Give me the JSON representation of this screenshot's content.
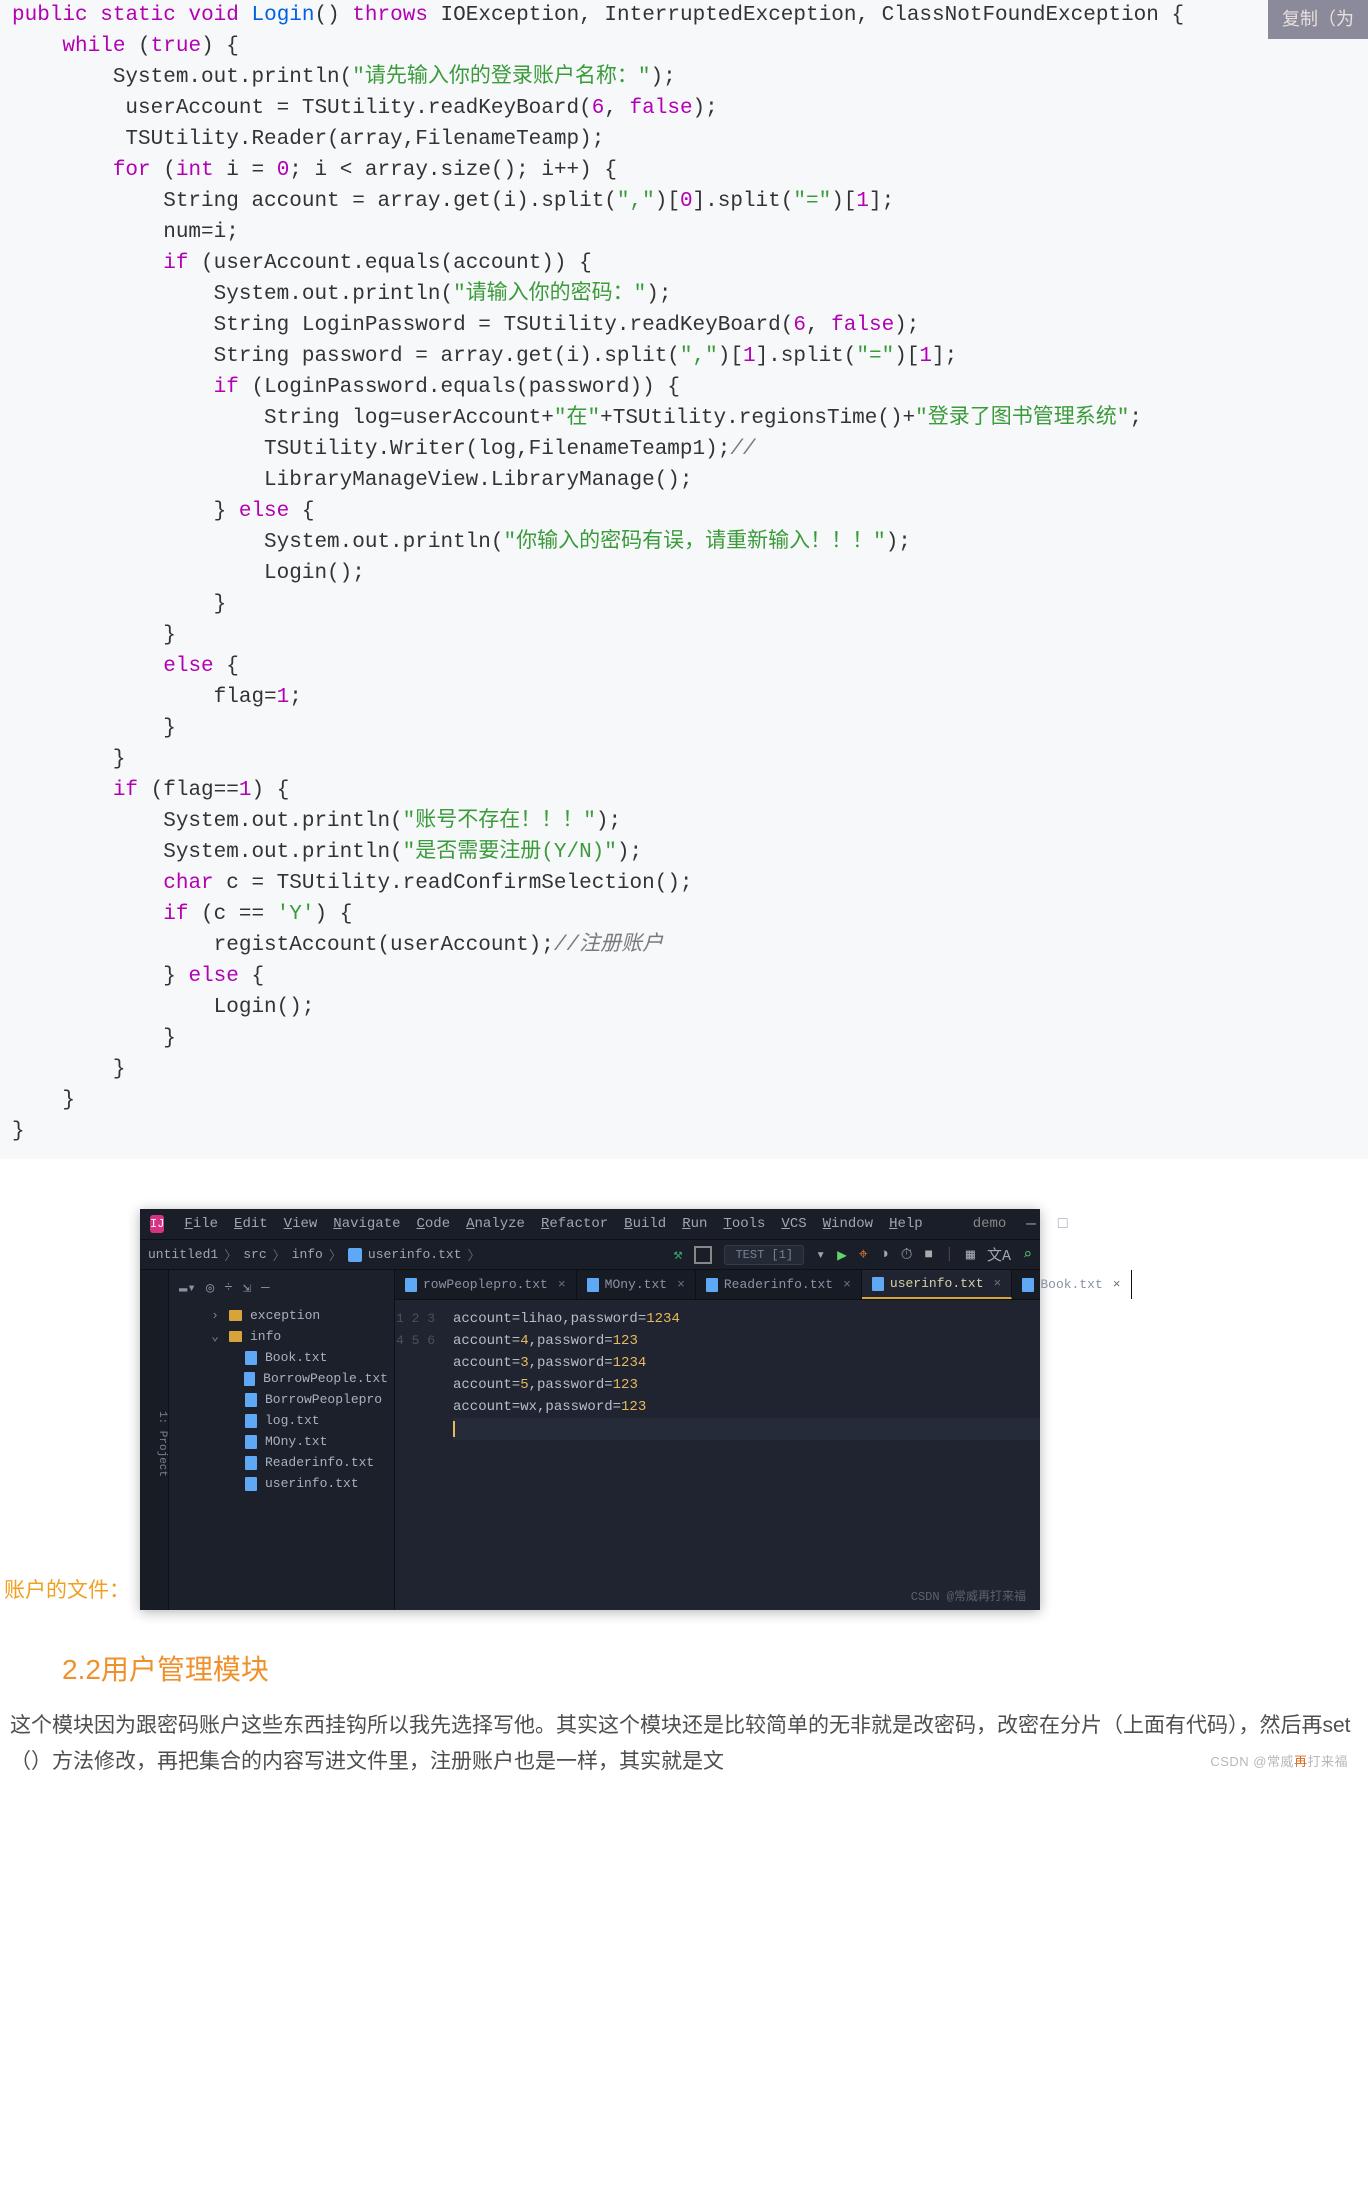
{
  "code": {
    "copy_label": "复制（为",
    "tokens": [
      [
        [
          "kw",
          "public"
        ],
        [
          "",
          0
        ],
        [
          "kw",
          "static"
        ],
        [
          "",
          0
        ],
        [
          "kw",
          "void"
        ],
        [
          "",
          0
        ],
        [
          "fn",
          "Login"
        ],
        [
          "",
          "() "
        ],
        [
          "kw",
          "throws"
        ],
        [
          "",
          " IOException, InterruptedException, ClassNotFoundException {"
        ]
      ],
      [
        [
          "",
          "    "
        ],
        [
          "kw",
          "while"
        ],
        [
          "",
          " ("
        ],
        [
          "bool",
          "true"
        ],
        [
          "",
          ") {"
        ]
      ],
      [
        [
          "",
          "        System.out.println("
        ],
        [
          "str",
          "\"请先输入你的登录账户名称：\""
        ],
        [
          "",
          ");"
        ]
      ],
      [
        [
          "",
          "         userAccount = TSUtility.readKeyBoard("
        ],
        [
          "num",
          "6"
        ],
        [
          "",
          ", "
        ],
        [
          "bool",
          "false"
        ],
        [
          "",
          ");"
        ]
      ],
      [
        [
          "",
          "         TSUtility.Reader(array,FilenameTeamp);"
        ]
      ],
      [
        [
          "",
          "        "
        ],
        [
          "kw",
          "for"
        ],
        [
          "",
          " ("
        ],
        [
          "kw",
          "int"
        ],
        [
          "",
          " i = "
        ],
        [
          "num",
          "0"
        ],
        [
          "",
          "; i < array.size(); i++) {"
        ]
      ],
      [
        [
          "",
          "            String account = array.get(i).split("
        ],
        [
          "str",
          "\",\""
        ],
        [
          "",
          ")["
        ],
        [
          "num",
          "0"
        ],
        [
          "",
          "].split("
        ],
        [
          "str",
          "\"=\""
        ],
        [
          "",
          ")["
        ],
        [
          "num",
          "1"
        ],
        [
          "",
          "];"
        ]
      ],
      [
        [
          "",
          "            num=i;"
        ]
      ],
      [
        [
          "",
          "            "
        ],
        [
          "kw",
          "if"
        ],
        [
          "",
          " (userAccount.equals(account)) {"
        ]
      ],
      [
        [
          "",
          "                System.out.println("
        ],
        [
          "str",
          "\"请输入你的密码：\""
        ],
        [
          "",
          ");"
        ]
      ],
      [
        [
          "",
          "                String LoginPassword = TSUtility.readKeyBoard("
        ],
        [
          "num",
          "6"
        ],
        [
          "",
          ", "
        ],
        [
          "bool",
          "false"
        ],
        [
          "",
          ");"
        ]
      ],
      [
        [
          "",
          "                String password = array.get(i).split("
        ],
        [
          "str",
          "\",\""
        ],
        [
          "",
          ")["
        ],
        [
          "num",
          "1"
        ],
        [
          "",
          "].split("
        ],
        [
          "str",
          "\"=\""
        ],
        [
          "",
          ")["
        ],
        [
          "num",
          "1"
        ],
        [
          "",
          "];"
        ]
      ],
      [
        [
          "",
          "                "
        ],
        [
          "kw",
          "if"
        ],
        [
          "",
          " (LoginPassword.equals(password)) {"
        ]
      ],
      [
        [
          "",
          "                    String log=userAccount+"
        ],
        [
          "str",
          "\"在\""
        ],
        [
          "",
          "+TSUtility.regionsTime()+"
        ],
        [
          "str",
          "\"登录了图书管理系统\""
        ],
        [
          "",
          ";"
        ]
      ],
      [
        [
          "",
          "                    TSUtility.Writer(log,FilenameTeamp1);"
        ],
        [
          "cmt",
          "//"
        ]
      ],
      [
        [
          "",
          "                    LibraryManageView.LibraryManage();"
        ]
      ],
      [
        [
          "",
          "                } "
        ],
        [
          "kw",
          "else"
        ],
        [
          "",
          " {"
        ]
      ],
      [
        [
          "",
          "                    System.out.println("
        ],
        [
          "str",
          "\"你输入的密码有误，请重新输入！！！\""
        ],
        [
          "",
          ");"
        ]
      ],
      [
        [
          "",
          "                    Login();"
        ]
      ],
      [
        [
          "",
          "                }"
        ]
      ],
      [
        [
          "",
          "            }"
        ]
      ],
      [
        [
          "",
          "            "
        ],
        [
          "kw",
          "else"
        ],
        [
          "",
          " {"
        ]
      ],
      [
        [
          "",
          "                flag="
        ],
        [
          "num",
          "1"
        ],
        [
          "",
          ";"
        ]
      ],
      [
        [
          "",
          "            }"
        ]
      ],
      [
        [
          "",
          "        }"
        ]
      ],
      [
        [
          "",
          "        "
        ],
        [
          "kw",
          "if"
        ],
        [
          "",
          " (flag=="
        ],
        [
          "num",
          "1"
        ],
        [
          "",
          ") {"
        ]
      ],
      [
        [
          "",
          "            System.out.println("
        ],
        [
          "str",
          "\"账号不存在！！！\""
        ],
        [
          "",
          ");"
        ]
      ],
      [
        [
          "",
          "            System.out.println("
        ],
        [
          "str",
          "\"是否需要注册(Y/N)\""
        ],
        [
          "",
          ");"
        ]
      ],
      [
        [
          "",
          "            "
        ],
        [
          "kw",
          "char"
        ],
        [
          "",
          " c = TSUtility.readConfirmSelection();"
        ]
      ],
      [
        [
          "",
          "            "
        ],
        [
          "kw",
          "if"
        ],
        [
          "",
          " (c == "
        ],
        [
          "str",
          "'Y'"
        ],
        [
          "",
          ") {"
        ]
      ],
      [
        [
          "",
          "                registAccount(userAccount);"
        ],
        [
          "cmt",
          "//注册账户"
        ]
      ],
      [
        [
          "",
          "            } "
        ],
        [
          "kw",
          "else"
        ],
        [
          "",
          " {"
        ]
      ],
      [
        [
          "",
          "                Login();"
        ]
      ],
      [
        [
          "",
          "            }"
        ]
      ],
      [
        [
          "",
          "        }"
        ]
      ],
      [
        [
          "",
          "    }"
        ]
      ],
      [
        [
          "",
          "}"
        ]
      ]
    ]
  },
  "ide": {
    "label": "账户的文件：",
    "menu": [
      "File",
      "Edit",
      "View",
      "Navigate",
      "Code",
      "Analyze",
      "Refactor",
      "Build",
      "Run",
      "Tools",
      "VCS",
      "Window",
      "Help"
    ],
    "project": "demo",
    "breadcrumb": [
      "untitled1",
      "src",
      "info",
      "userinfo.txt"
    ],
    "test_chip": "TEST [1]",
    "tree": {
      "items": [
        {
          "type": "folder",
          "label": "exception",
          "level": 2,
          "chev": "›"
        },
        {
          "type": "folder",
          "label": "info",
          "level": 2,
          "chev": "⌄"
        },
        {
          "type": "file",
          "label": "Book.txt",
          "level": 3
        },
        {
          "type": "file",
          "label": "BorrowPeople.txt",
          "level": 3
        },
        {
          "type": "file",
          "label": "BorrowPeoplepro",
          "level": 3
        },
        {
          "type": "file",
          "label": "log.txt",
          "level": 3
        },
        {
          "type": "file",
          "label": "MOny.txt",
          "level": 3
        },
        {
          "type": "file",
          "label": "Readerinfo.txt",
          "level": 3
        },
        {
          "type": "file",
          "label": "userinfo.txt",
          "level": 3
        }
      ]
    },
    "tabs": [
      {
        "label": "rowPeoplepro.txt",
        "active": false
      },
      {
        "label": "MOny.txt",
        "active": false
      },
      {
        "label": "Readerinfo.txt",
        "active": false
      },
      {
        "label": "userinfo.txt",
        "active": true
      },
      {
        "label": "Book.txt",
        "active": false
      }
    ],
    "editor_lines": [
      "account=lihao,password=1234",
      "account=4,password=123",
      "account=3,password=1234",
      "account=5,password=123",
      "account=wx,password=123",
      ""
    ],
    "watermark": "CSDN @常威再打来福"
  },
  "section_title": "2.2用户管理模块",
  "paragraph": "这个模块因为跟密码账户这些东西挂钩所以我先选择写他。其实这个模块还是比较简单的无非就是改密码，改密在分片（上面有代码），然后再set（）方法修改，再把集合的内容写进文件里，注册账户也是一样，其实就是文",
  "page_watermark_pre": "CSDN @常威",
  "page_watermark_post": "打来福"
}
